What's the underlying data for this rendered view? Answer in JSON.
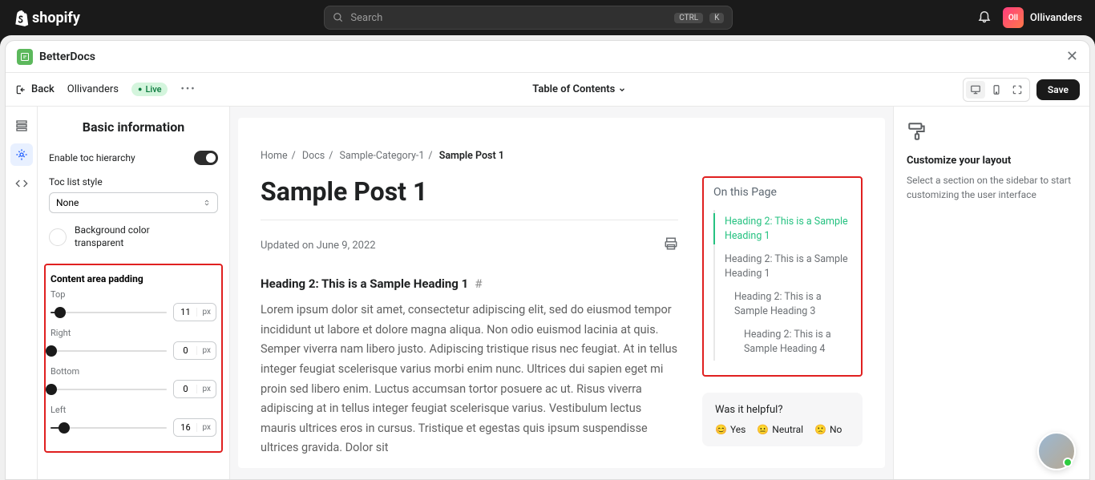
{
  "topbar": {
    "brand": "shopify",
    "search_placeholder": "Search",
    "kbd1": "CTRL",
    "kbd2": "K",
    "username": "Ollivanders",
    "avatar_initials": "Oll"
  },
  "app": {
    "name": "BetterDocs"
  },
  "toolbar": {
    "back_label": "Back",
    "store_name": "Ollivanders",
    "live_label": "Live",
    "center_label": "Table of Contents",
    "save_label": "Save"
  },
  "sidebar": {
    "title": "Basic information",
    "toc_hierarchy_label": "Enable toc hierarchy",
    "list_style_label": "Toc list style",
    "list_style_value": "None",
    "bgcolor_label_1": "Background color",
    "bgcolor_label_2": "transparent",
    "padding_section": "Content area padding",
    "paddings": [
      {
        "label": "Top",
        "value": "11",
        "unit": "px",
        "pct": 8
      },
      {
        "label": "Right",
        "value": "0",
        "unit": "px",
        "pct": 1
      },
      {
        "label": "Bottom",
        "value": "0",
        "unit": "px",
        "pct": 1
      },
      {
        "label": "Left",
        "value": "16",
        "unit": "px",
        "pct": 12
      }
    ]
  },
  "page": {
    "crumbs": {
      "c1": "Home",
      "c2": "Docs",
      "c3": "Sample-Category-1",
      "c4": "Sample Post 1"
    },
    "title": "Sample Post 1",
    "updated": "Updated on June 9, 2022",
    "h2": "Heading 2: This is a Sample Heading 1",
    "hash": "#",
    "body": "Lorem ipsum dolor sit amet, consectetur adipiscing elit, sed do eiusmod tempor incididunt ut labore et dolore magna aliqua. Non odio euismod lacinia at quis. Semper viverra nam libero justo. Adipiscing tristique risus nec feugiat. At in tellus integer feugiat scelerisque varius morbi enim nunc. Ultrices dui sapien eget mi proin sed libero enim. Luctus accumsan tortor posuere ac ut. Risus viverra adipiscing at in tellus integer feugiat scelerisque varius. Vestibulum lectus mauris ultrices eros in cursus. Tristique et egestas quis ipsum suspendisse ultrices gravida. Dolor sit"
  },
  "toc": {
    "title": "On this Page",
    "items": [
      "Heading 2: This is a Sample Heading 1",
      "Heading 2: This is a Sample Heading 1",
      "Heading 2: This is a Sample Heading 3",
      "Heading 2: This is a Sample Heading 4"
    ]
  },
  "feedback": {
    "title": "Was it helpful?",
    "yes": "Yes",
    "neutral": "Neutral",
    "no": "No"
  },
  "rightpanel": {
    "title": "Customize your layout",
    "desc": "Select a section on the sidebar to start customizing the user interface"
  }
}
